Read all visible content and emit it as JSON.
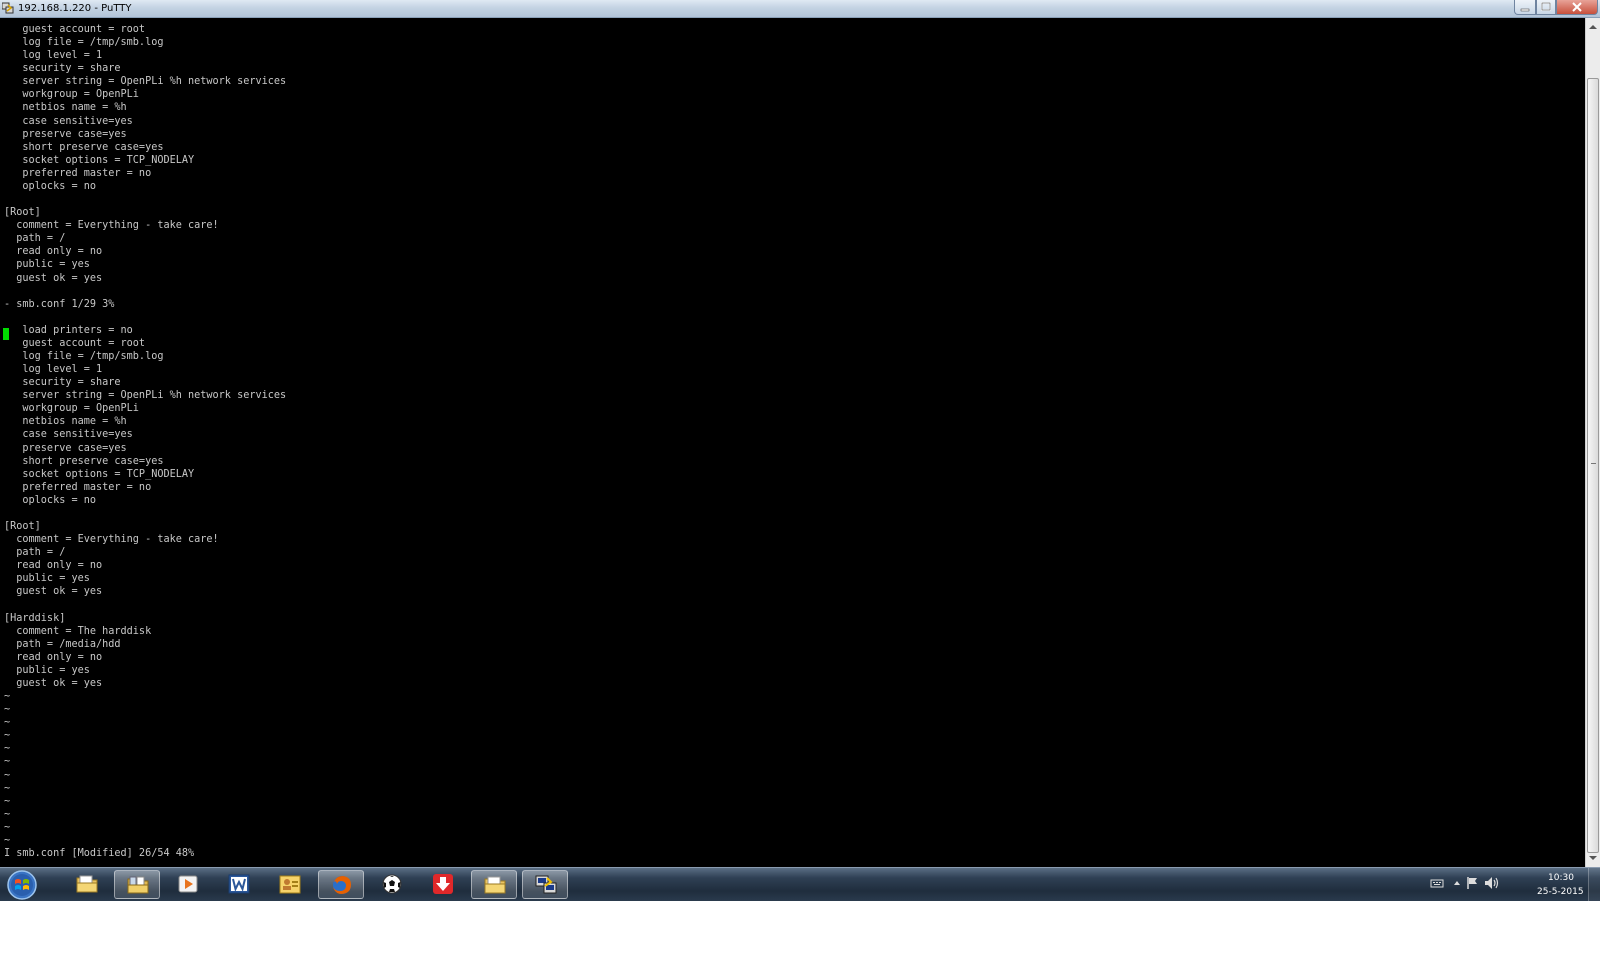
{
  "window": {
    "title": "192.168.1.220 - PuTTY"
  },
  "terminal": {
    "lines": [
      "   guest account = root",
      "   log file = /tmp/smb.log",
      "   log level = 1",
      "   security = share",
      "   server string = OpenPLi %h network services",
      "   workgroup = OpenPLi",
      "   netbios name = %h",
      "   case sensitive=yes",
      "   preserve case=yes",
      "   short preserve case=yes",
      "   socket options = TCP_NODELAY",
      "   preferred master = no",
      "   oplocks = no",
      "",
      "[Root]",
      "  comment = Everything - take care!",
      "  path = /",
      "  read only = no",
      "  public = yes",
      "  guest ok = yes",
      "",
      "- smb.conf 1/29 3%",
      "",
      "   load printers = no",
      "   guest account = root",
      "   log file = /tmp/smb.log",
      "   log level = 1",
      "   security = share",
      "   server string = OpenPLi %h network services",
      "   workgroup = OpenPLi",
      "   netbios name = %h",
      "   case sensitive=yes",
      "   preserve case=yes",
      "   short preserve case=yes",
      "   socket options = TCP_NODELAY",
      "   preferred master = no",
      "   oplocks = no",
      "",
      "[Root]",
      "  comment = Everything - take care!",
      "  path = /",
      "  read only = no",
      "  public = yes",
      "  guest ok = yes",
      "",
      "[Harddisk]",
      "  comment = The harddisk",
      "  path = /media/hdd",
      "  read only = no",
      "  public = yes",
      "  guest ok = yes",
      "~",
      "~",
      "~",
      "~",
      "~",
      "~",
      "~",
      "~",
      "~",
      "~",
      "~",
      "~",
      "I smb.conf [Modified] 26/54 48%"
    ],
    "text_color": "#c8c8c8",
    "background": "#000000",
    "cursor_color": "#00dd00"
  },
  "taskbar": {
    "pinned": [
      {
        "name": "windows-explorer",
        "icon": "folder-icon"
      },
      {
        "name": "libraries",
        "icon": "library-folder-icon"
      },
      {
        "name": "media-player",
        "icon": "media-play-icon"
      },
      {
        "name": "word",
        "icon": "word-icon"
      },
      {
        "name": "outlook",
        "icon": "contacts-icon"
      },
      {
        "name": "firefox",
        "icon": "firefox-icon"
      },
      {
        "name": "football-app",
        "icon": "football-icon"
      },
      {
        "name": "downloader",
        "icon": "download-arrow-icon"
      },
      {
        "name": "file-manager",
        "icon": "folder-icon"
      },
      {
        "name": "putty",
        "icon": "putty-icon"
      }
    ],
    "clock": {
      "time": "10:30",
      "date": "25-5-2015"
    }
  }
}
